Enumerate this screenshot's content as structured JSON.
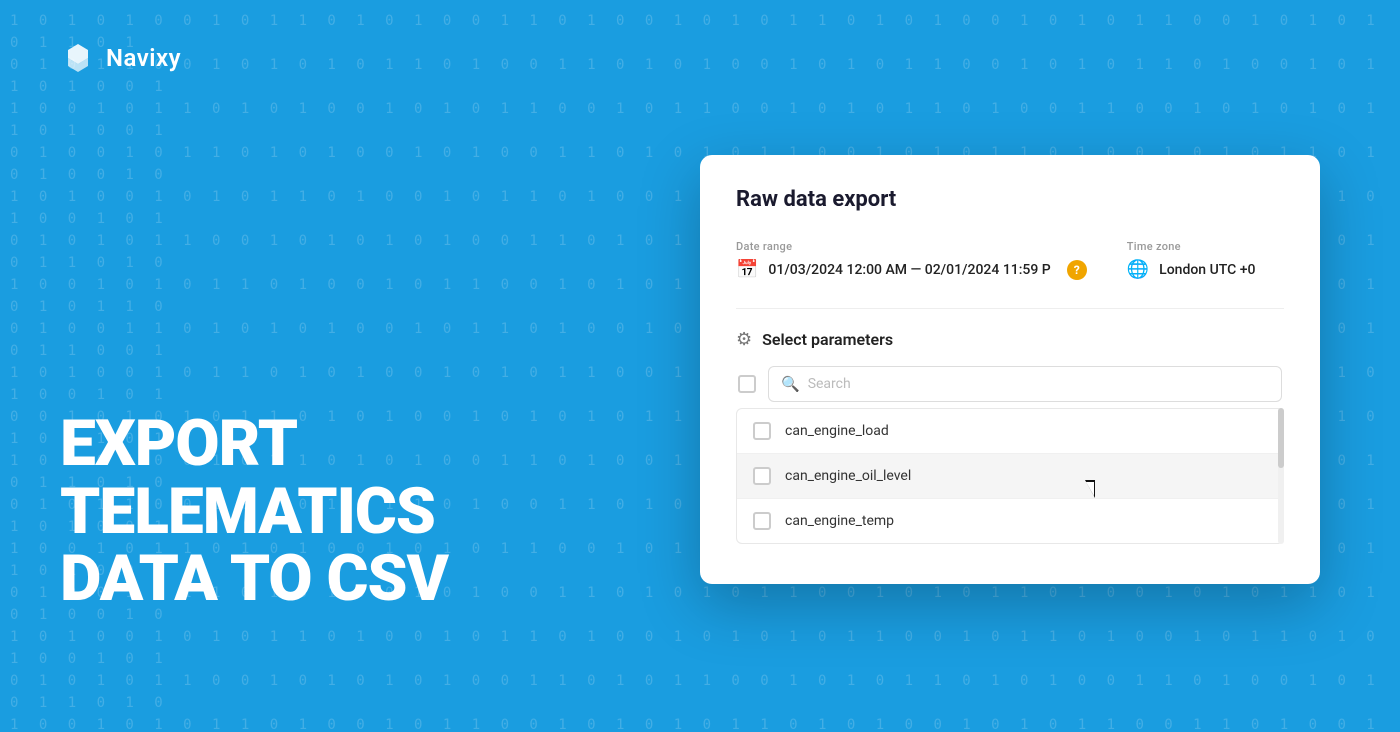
{
  "background": {
    "color": "#1a9de0"
  },
  "logo": {
    "text": "Navixy"
  },
  "headline": {
    "line1": "EXPORT",
    "line2": "TELEMATICS",
    "line3": "DATA TO CSV"
  },
  "modal": {
    "title": "Raw data export",
    "date_range": {
      "label": "Date range",
      "value": "01/03/2024 12:00 AM — 02/01/2024 11:59 P"
    },
    "timezone": {
      "label": "Time zone",
      "value": "London UTC +0"
    },
    "select_params": {
      "label": "Select parameters",
      "search_placeholder": "Search"
    },
    "parameters": [
      {
        "name": "can_engine_load",
        "highlighted": false
      },
      {
        "name": "can_engine_oil_level",
        "highlighted": true
      },
      {
        "name": "can_engine_temp",
        "highlighted": false
      }
    ]
  },
  "binary_text": "1 0 1 1 0 1 0 1 0 0 1 0 1 1 0 1 0 1 0 0 1 1 0 1 0 1 0 0 1 0 1 0 1 0 1 1 0 1 0 1 0 0 1 0 1 1 0 1 0 1 0 0 1 1 0 1 0 1 0 0 1 0 1 0 1 0 1 1 0 1 0 1 0 0 1 0 1 1 0 1 0 1 0 0 1 1 0 1 0 1 0 0 1 0 1 0 1 0 1 1 0 1 0 1 0 0 1 0 1 1 0 1 0 1 0 0 1 1 0 1 0 1 0 0 1 0 1 0 1 0"
}
